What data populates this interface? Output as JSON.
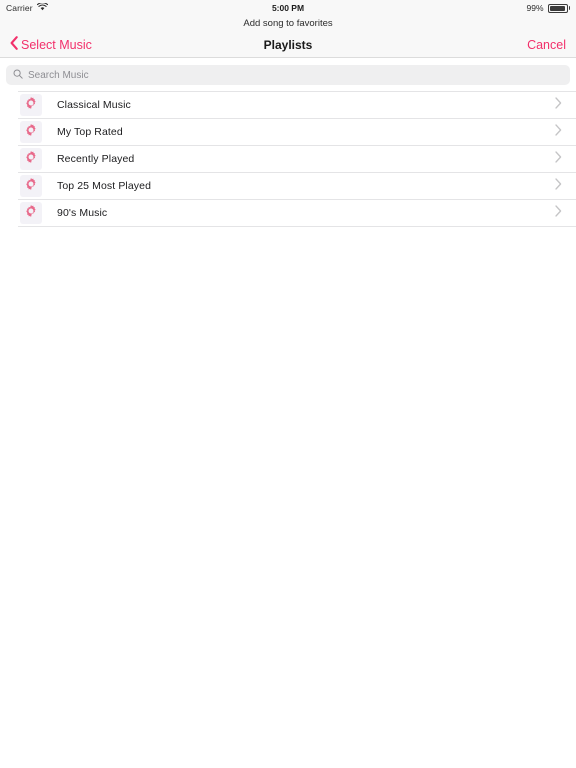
{
  "status_bar": {
    "carrier": "Carrier",
    "wifi_icon": "wifi-icon",
    "time": "5:00 PM",
    "battery_percent": "99%",
    "battery_icon": "battery-icon"
  },
  "nav_bar": {
    "prompt": "Add song to favorites",
    "back_icon": "chevron-left-icon",
    "back_label": "Select Music",
    "title": "Playlists",
    "cancel_label": "Cancel"
  },
  "search": {
    "icon": "search-icon",
    "placeholder": "Search Music",
    "value": ""
  },
  "list": {
    "row_icon": "gear-icon",
    "accessory_icon": "chevron-right-icon",
    "items": [
      {
        "label": "Classical Music"
      },
      {
        "label": "My Top Rated"
      },
      {
        "label": "Recently Played"
      },
      {
        "label": "Top 25 Most Played"
      },
      {
        "label": "90's Music"
      }
    ]
  },
  "colors": {
    "accent": "#f2306b",
    "icon_pink": "#e8698a",
    "bar_background": "#f8f8f8",
    "search_background": "#efeff0",
    "separator": "#e4e4e6",
    "tile_background": "#f3f2f7"
  }
}
